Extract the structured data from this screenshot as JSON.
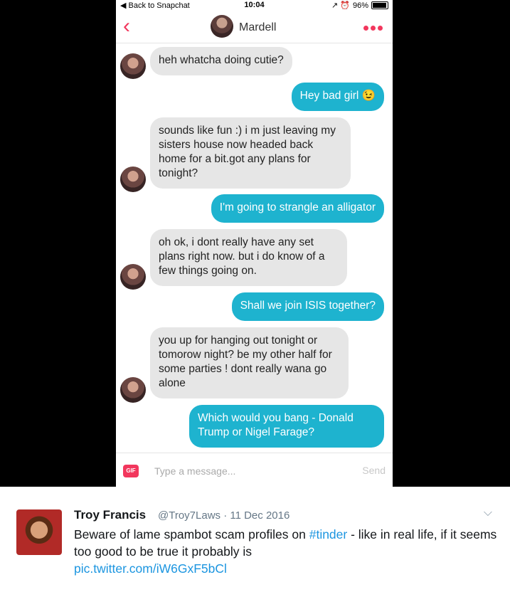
{
  "status_bar": {
    "back": "◀ Back to Snapchat",
    "time": "10:04",
    "battery": "96%",
    "signal": "↗ ⏰"
  },
  "chat_header": {
    "name": "Mardell"
  },
  "messages": [
    {
      "from": "them",
      "text": "heh whatcha doing cutie?"
    },
    {
      "from": "me",
      "text": "Hey bad girl 😉"
    },
    {
      "from": "them",
      "text": "sounds like fun :) i m just leaving my sisters house now headed back home for a bit.got any plans for tonight?"
    },
    {
      "from": "me",
      "text": "I'm going to strangle an alligator"
    },
    {
      "from": "them",
      "text": "oh ok, i dont really have any set plans right now. but i do know of a few things going on."
    },
    {
      "from": "me",
      "text": "Shall we join ISIS together?"
    },
    {
      "from": "them",
      "text": "you up for hanging out tonight or tomorow night? be my other half for some parties ! dont really wana go alone"
    },
    {
      "from": "me",
      "text": "Which would you bang - Donald Trump or Nigel Farage?"
    }
  ],
  "composer": {
    "gif": "GIF",
    "placeholder": "Type a message...",
    "send": "Send"
  },
  "tweet": {
    "name": "Troy Francis",
    "handle": "@Troy7Laws",
    "date": "· 11 Dec 2016",
    "text_before": "Beware of lame spambot scam profiles on ",
    "hashtag": "#tinder",
    "text_after": " - like in real life, if it seems too good to be true it probably is",
    "link": "pic.twitter.com/iW6GxF5bCl"
  },
  "colors": {
    "accent": "#f2375d",
    "outgoing": "#1eb3cf",
    "incoming": "#e6e6e6",
    "twitter_link": "#1b95e0"
  }
}
